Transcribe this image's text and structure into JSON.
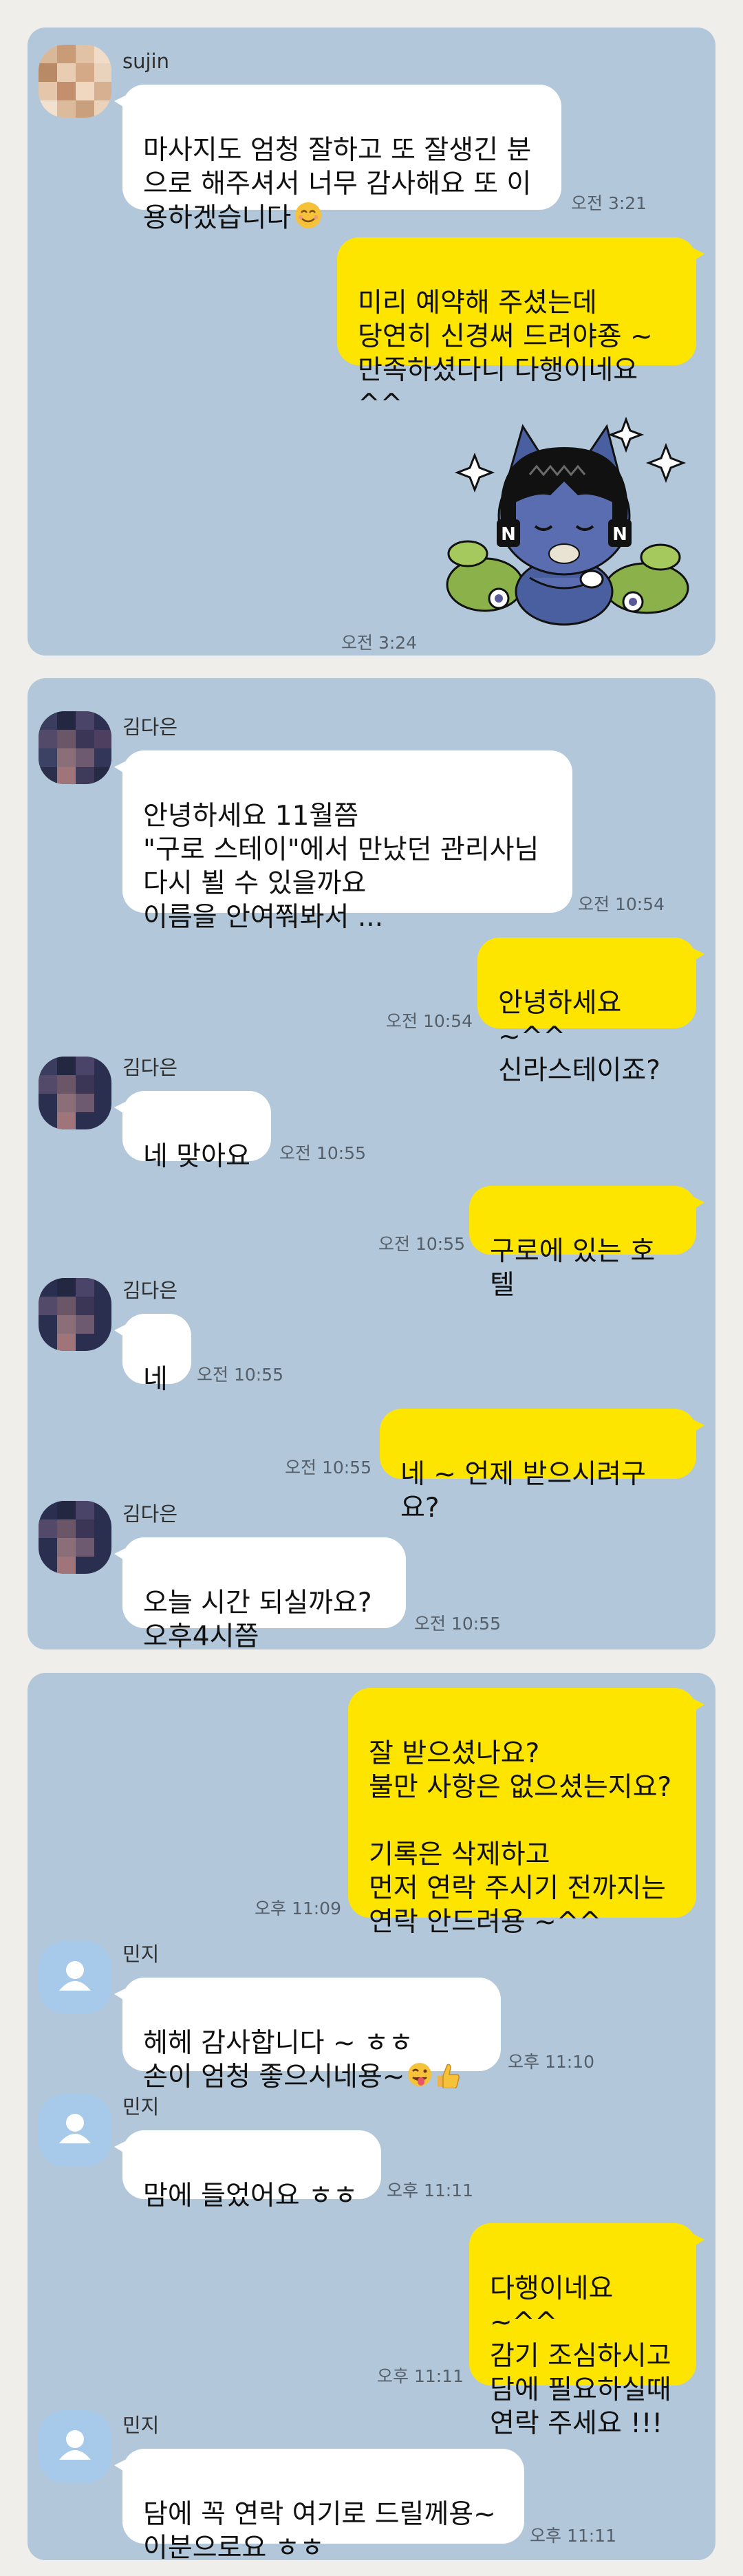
{
  "colors": {
    "page_background": "#f0eeeb",
    "chat_background": "#b2c7da",
    "incoming_bubble": "#ffffff",
    "outgoing_bubble": "#fee500",
    "time_text": "#555f69"
  },
  "panels": [
    {
      "messages": [
        {
          "sender": "sujin",
          "text": "마사지도 엄청 잘하고 또 잘생긴 분\n으로 해주셔서 너무 감사해요 또 이\n용하겠습니다",
          "emoji": "smiling-face-icon",
          "time": "오전 3:21"
        },
        {
          "sender": "me",
          "text": "미리 예약해 주셨는데\n당연히 신경써 드려야죵 ~\n만족하셨다니 다행이네요 ^^"
        },
        {
          "sender": "me",
          "sticker": "kakao-neo-sticker",
          "time": "오전 3:24"
        }
      ]
    },
    {
      "messages": [
        {
          "sender": "김다은",
          "text": "안녕하세요 11월쯤\n\"구로 스테이\"에서 만났던 관리사님\n다시 뵐 수 있을까요\n이름을 안여쭤봐서 ...",
          "time": "오전 10:54"
        },
        {
          "sender": "me",
          "text": "안녕하세요 ~^^\n신라스테이죠?",
          "time": "오전 10:54"
        },
        {
          "sender": "김다은",
          "text": "네 맞아요",
          "time": "오전 10:55"
        },
        {
          "sender": "me",
          "text": "구로에 있는 호텔",
          "time": "오전 10:55"
        },
        {
          "sender": "김다은",
          "text": "네",
          "time": "오전 10:55"
        },
        {
          "sender": "me",
          "text": "네 ~ 언제 받으시려구요?",
          "time": "오전 10:55"
        },
        {
          "sender": "김다은",
          "text": "오늘  시간 되실까요?\n오후4시쯤",
          "time": "오전 10:55"
        }
      ]
    },
    {
      "messages": [
        {
          "sender": "me",
          "text": "잘 받으셨나요?\n불만 사항은 없으셨는지요?\n\n기록은 삭제하고\n먼저 연락 주시기 전까지는\n연락 안드려용 ~^^",
          "time": "오후 11:09"
        },
        {
          "sender": "민지",
          "text": "헤헤 감사합니다 ~ ㅎㅎ\n손이 엄청 좋으시네용~",
          "emoji": "winking-tongue-thumbs-up-icon",
          "time": "오후 11:10"
        },
        {
          "sender": "민지",
          "text": "맘에 들었어요 ㅎㅎ",
          "time": "오후 11:11"
        },
        {
          "sender": "me",
          "text": "다행이네요 ~^^\n감기 조심하시고\n담에 필요하실때\n연락 주세요 !!!",
          "time": "오후 11:11"
        },
        {
          "sender": "민지",
          "text": "담에 꼭 연락 여기로 드릴께용~\n이분으로요 ㅎㅎ",
          "time": "오후 11:11"
        }
      ]
    }
  ]
}
